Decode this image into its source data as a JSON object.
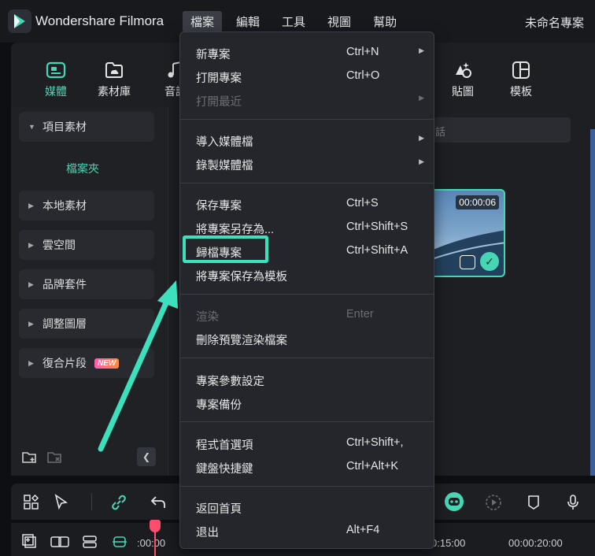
{
  "app": {
    "name": "Wondershare Filmora",
    "project_name": "未命名專案"
  },
  "menubar": {
    "items": [
      {
        "label": "檔案",
        "active": true
      },
      {
        "label": "編輯"
      },
      {
        "label": "工具"
      },
      {
        "label": "視圖"
      },
      {
        "label": "幫助"
      }
    ]
  },
  "tabs": [
    {
      "label": "媒體",
      "icon": "media-icon",
      "active": true
    },
    {
      "label": "素材庫",
      "icon": "library-icon"
    },
    {
      "label": "音訊",
      "icon": "audio-icon"
    },
    {
      "label": "貼圖",
      "icon": "sticker-icon"
    },
    {
      "label": "模板",
      "icon": "template-icon"
    }
  ],
  "sidebar": {
    "project_media": "項目素材",
    "folder": "檔案夾",
    "items": [
      {
        "label": "本地素材"
      },
      {
        "label": "雲空間"
      },
      {
        "label": "品牌套件"
      },
      {
        "label": "調整圖層"
      },
      {
        "label": "復合片段",
        "badge": "NEW"
      }
    ]
  },
  "content": {
    "search_placeholder": "話",
    "thumbnail_duration": "00:00:06"
  },
  "file_menu": {
    "groups": [
      [
        {
          "label": "新專案",
          "shortcut": "Ctrl+N",
          "submenu": true
        },
        {
          "label": "打開專案",
          "shortcut": "Ctrl+O"
        },
        {
          "label": "打開最近",
          "disabled": true,
          "submenu": true
        }
      ],
      [
        {
          "label": "導入媒體檔",
          "submenu": true
        },
        {
          "label": "錄製媒體檔",
          "submenu": true
        }
      ],
      [
        {
          "label": "保存專案",
          "shortcut": "Ctrl+S"
        },
        {
          "label": "將專案另存為...",
          "shortcut": "Ctrl+Shift+S"
        },
        {
          "label": "歸檔專案",
          "shortcut": "Ctrl+Shift+A",
          "highlighted": true
        },
        {
          "label": "將專案保存為模板"
        }
      ],
      [
        {
          "label": "渲染",
          "shortcut": "Enter",
          "disabled": true
        },
        {
          "label": "刪除預覽渲染檔案"
        }
      ],
      [
        {
          "label": "專案參數設定"
        },
        {
          "label": "專案備份"
        }
      ],
      [
        {
          "label": "程式首選項",
          "shortcut": "Ctrl+Shift+,"
        },
        {
          "label": "鍵盤快捷鍵",
          "shortcut": "Ctrl+Alt+K"
        }
      ],
      [
        {
          "label": "返回首頁"
        },
        {
          "label": "退出",
          "shortcut": "Alt+F4"
        }
      ]
    ]
  },
  "timeline": {
    "times": [
      ":00:00",
      "0:15:00",
      "00:00:20:00"
    ]
  },
  "colors": {
    "accent": "#47d6b4",
    "highlight_box": "#3de0bd",
    "playhead": "#ff4d6d"
  }
}
